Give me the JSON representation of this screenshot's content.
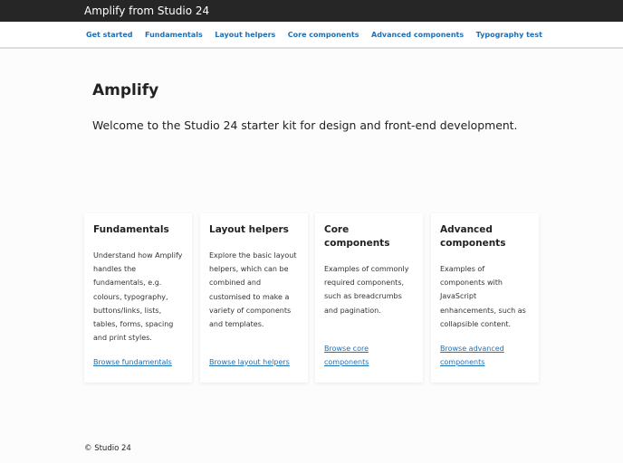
{
  "header": {
    "title": "Amplify from Studio 24"
  },
  "nav": [
    "Get started",
    "Fundamentals",
    "Layout helpers",
    "Core components",
    "Advanced components",
    "Typography test"
  ],
  "main": {
    "title": "Amplify",
    "lead": "Welcome to the Studio 24 starter kit for design and front-end development."
  },
  "cards": [
    {
      "title": "Fundamentals",
      "text": "Understand how Amplify handles the fundamentals, e.g. colours, typography, buttons/links, lists, tables, forms, spacing and print styles.",
      "link": "Browse fundamentals"
    },
    {
      "title": "Layout helpers",
      "text": "Explore the basic layout helpers, which can be combined and customised to make a variety of components and templates.",
      "link": "Browse layout helpers"
    },
    {
      "title": "Core components",
      "text": "Examples of commonly required components, such as breadcrumbs and pagination.",
      "link": "Browse core components"
    },
    {
      "title": "Advanced components",
      "text": "Examples of components with JavaScript enhancements, such as collapsible content.",
      "link": "Browse advanced components"
    }
  ],
  "footer": {
    "text": "© Studio 24"
  }
}
